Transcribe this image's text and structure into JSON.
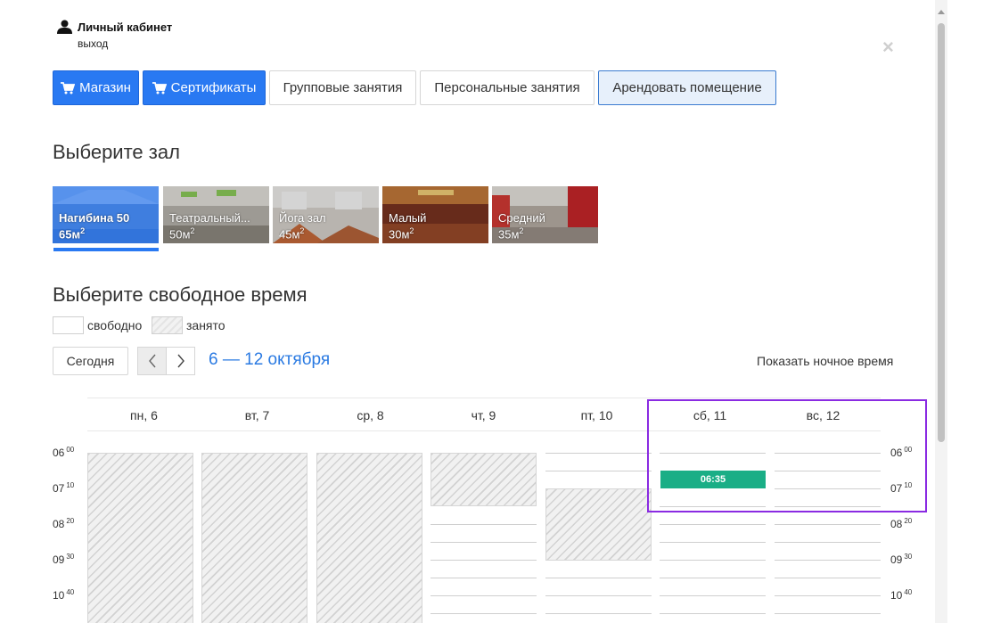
{
  "account": {
    "name": "Личный кабинет",
    "logout": "выход"
  },
  "close_symbol": "×",
  "tabs": [
    {
      "label": "Магазин",
      "style": "blue",
      "icon": "cart-icon"
    },
    {
      "label": "Сертификаты",
      "style": "blue",
      "icon": "cart-icon"
    },
    {
      "label": "Групповые занятия",
      "style": "plain"
    },
    {
      "label": "Персональные занятия",
      "style": "plain"
    },
    {
      "label": "Арендовать помещение",
      "style": "active"
    }
  ],
  "halls_title": "Выберите зал",
  "halls": [
    {
      "name": "Нагибина 50",
      "area": "65м",
      "selected": true
    },
    {
      "name": "Театральный...",
      "area": "50м",
      "selected": false
    },
    {
      "name": "Йога зал",
      "area": "45м",
      "selected": false
    },
    {
      "name": "Малый",
      "area": "30м",
      "selected": false
    },
    {
      "name": "Средний",
      "area": "35м",
      "selected": false
    }
  ],
  "area_sup": "2",
  "time_title": "Выберите свободное время",
  "legend": {
    "free": "свободно",
    "busy": "занято"
  },
  "toolbar": {
    "today": "Сегодня",
    "range": "6 — 12 октября",
    "night": "Показать ночное время"
  },
  "calendar": {
    "days": [
      "пн, 6",
      "вт, 7",
      "ср, 8",
      "чт, 9",
      "пт, 10",
      "сб, 11",
      "вс, 12"
    ],
    "times": [
      {
        "h": "06",
        "m": "00"
      },
      {
        "h": "07",
        "m": "10"
      },
      {
        "h": "08",
        "m": "20"
      },
      {
        "h": "09",
        "m": "30"
      },
      {
        "h": "10",
        "m": "40"
      }
    ],
    "slot_label": "06:35"
  },
  "colors": {
    "accent": "#2979f2",
    "slot": "#1aae86",
    "range": "#2a7ae2",
    "highlight": "#8a2be2"
  }
}
